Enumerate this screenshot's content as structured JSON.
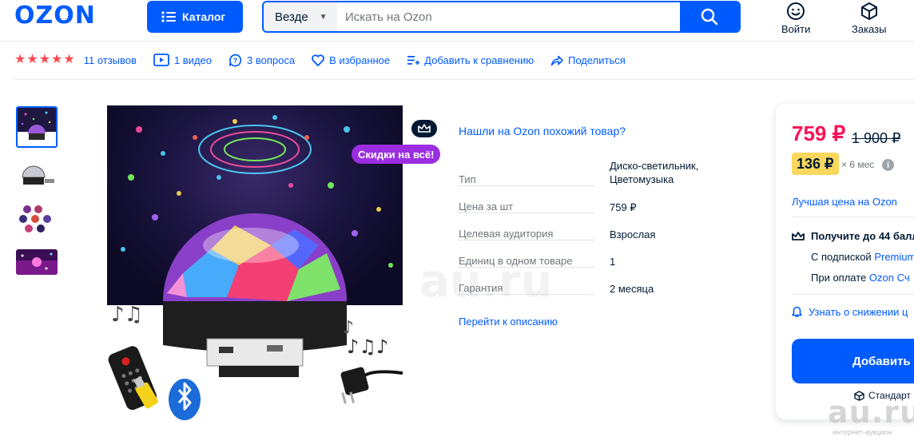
{
  "header": {
    "logo": "OZON",
    "catalog_label": "Каталог",
    "search_scope": "Везде",
    "search_placeholder": "Искать на Ozon",
    "login_label": "Войти",
    "orders_label": "Заказы"
  },
  "actions": {
    "rating": 5,
    "reviews": "11 отзывов",
    "videos": "1 видео",
    "questions": "3 вопроса",
    "favorites": "В избранное",
    "compare": "Добавить к сравнению",
    "share": "Поделиться"
  },
  "gallery": {
    "thumbnails": [
      "thumb-1",
      "thumb-2",
      "thumb-3",
      "thumb-4"
    ],
    "selected_index": 0
  },
  "promo": {
    "badge": "Скидки на всё!"
  },
  "product": {
    "similar_link": "Нашли на Ozon похожий товар?",
    "specs": [
      {
        "key": "Тип",
        "value": "Диско-светильник, Цветомузыка"
      },
      {
        "key": "Цена за шт",
        "value": "759 ₽"
      },
      {
        "key": "Целевая аудитория",
        "value": "Взрослая"
      },
      {
        "key": "Единиц в одном товаре",
        "value": "1"
      },
      {
        "key": "Гарантия",
        "value": "2 месяца"
      }
    ],
    "description_link": "Перейти к описанию"
  },
  "price_card": {
    "price": "759 ₽",
    "old_price": "1 900 ₽",
    "installment": "136 ₽",
    "installment_term": "× 6 мес",
    "info_icon": "i",
    "best_price": "Лучшая цена на Ozon",
    "bonus_title": "Получите до 44 балл",
    "bonus_subscription_prefix": "С подпиской ",
    "bonus_subscription_link": "Premium",
    "bonus_card_prefix": "При оплате ",
    "bonus_card_link": "Ozon Сч",
    "notify": "Узнать о снижении ц",
    "add_button": "Добавить в",
    "delivery": "Стандарт"
  },
  "watermark": {
    "text": "au.ru",
    "sub": "интернет-аукцион"
  },
  "colors": {
    "brand": "#005bff",
    "price": "#f91155",
    "installment_bg": "#fbd75d",
    "promo": "#9b2ee0",
    "stars": "#f9494f"
  }
}
